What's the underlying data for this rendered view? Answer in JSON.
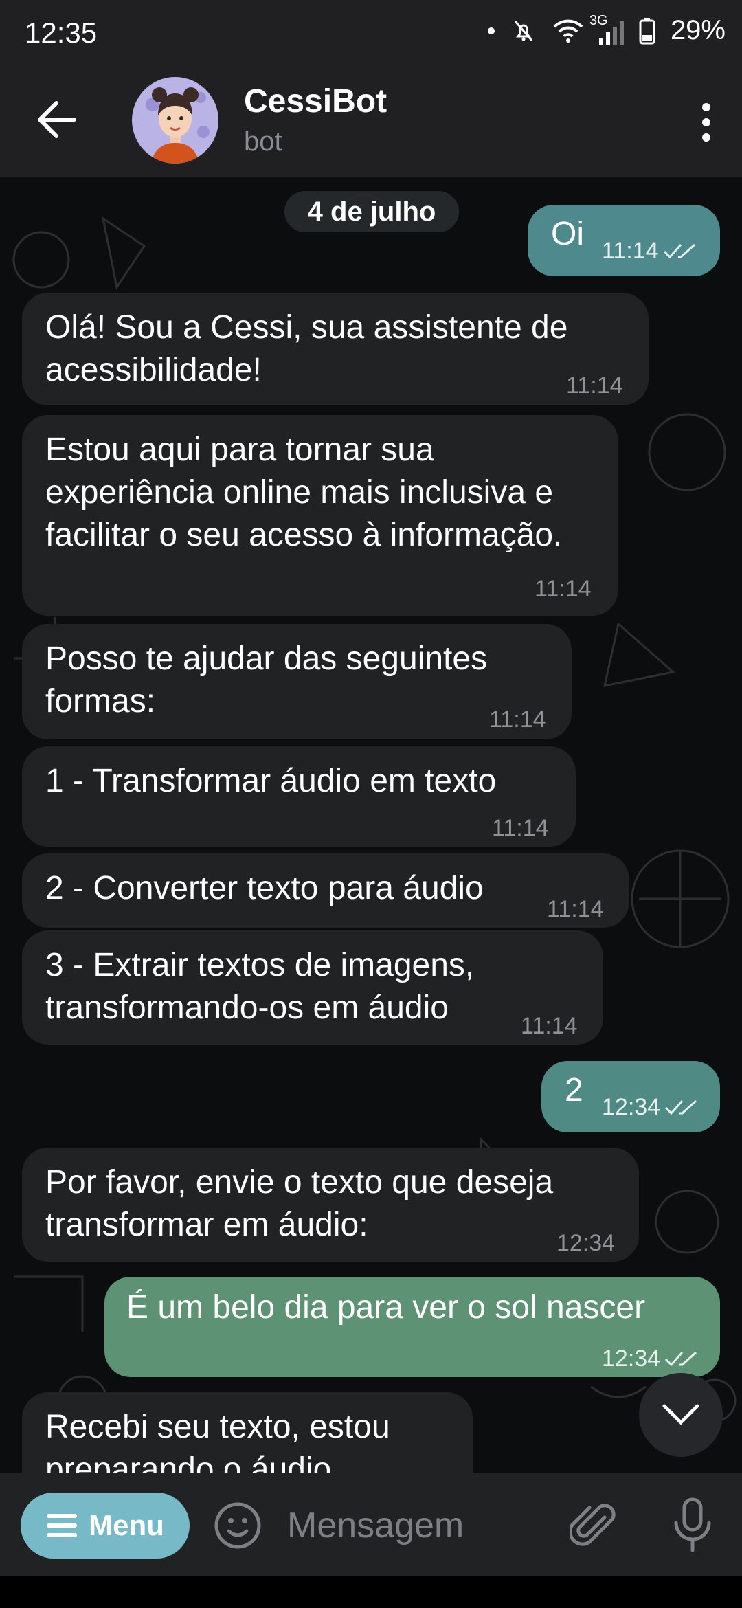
{
  "status": {
    "time": "12:35",
    "signal": "3G",
    "battery": "29%"
  },
  "header": {
    "name": "CessiBot",
    "subtitle": "bot"
  },
  "date_chip": "4 de julho",
  "messages": [
    {
      "dir": "out",
      "text": "Oi",
      "time": "11:14"
    },
    {
      "dir": "in",
      "text": "Olá! Sou a Cessi, sua assistente de acessibilidade!",
      "time": "11:14"
    },
    {
      "dir": "in",
      "text": "Estou aqui para tornar sua experiência online mais inclusiva e facilitar o seu acesso à informação.",
      "time": "11:14"
    },
    {
      "dir": "in",
      "text": "Posso te ajudar das seguintes formas:",
      "time": "11:14"
    },
    {
      "dir": "in",
      "text": "1 - Transformar áudio em texto",
      "time": "11:14"
    },
    {
      "dir": "in",
      "text": "2 - Converter texto para áudio",
      "time": "11:14"
    },
    {
      "dir": "in",
      "text": "3 - Extrair textos de imagens, transformando-os em áudio",
      "time": "11:14"
    },
    {
      "dir": "out",
      "text": "2",
      "time": "12:34"
    },
    {
      "dir": "in",
      "text": "Por favor, envie o texto que deseja transformar em áudio:",
      "time": "12:34"
    },
    {
      "dir": "out",
      "text": "É um belo dia para ver o sol nascer",
      "time": "12:34"
    },
    {
      "dir": "in",
      "text": "Recebi seu texto, estou preparando o áudio...",
      "time": ""
    }
  ],
  "input": {
    "menu_label": "Menu",
    "placeholder": "Mensagem"
  },
  "colors": {
    "bar": "#202022",
    "incoming": "#212224",
    "outgoing_teal": "#4e8a8d",
    "outgoing_green": "#5e9274",
    "menu_button": "#77b9c7"
  }
}
